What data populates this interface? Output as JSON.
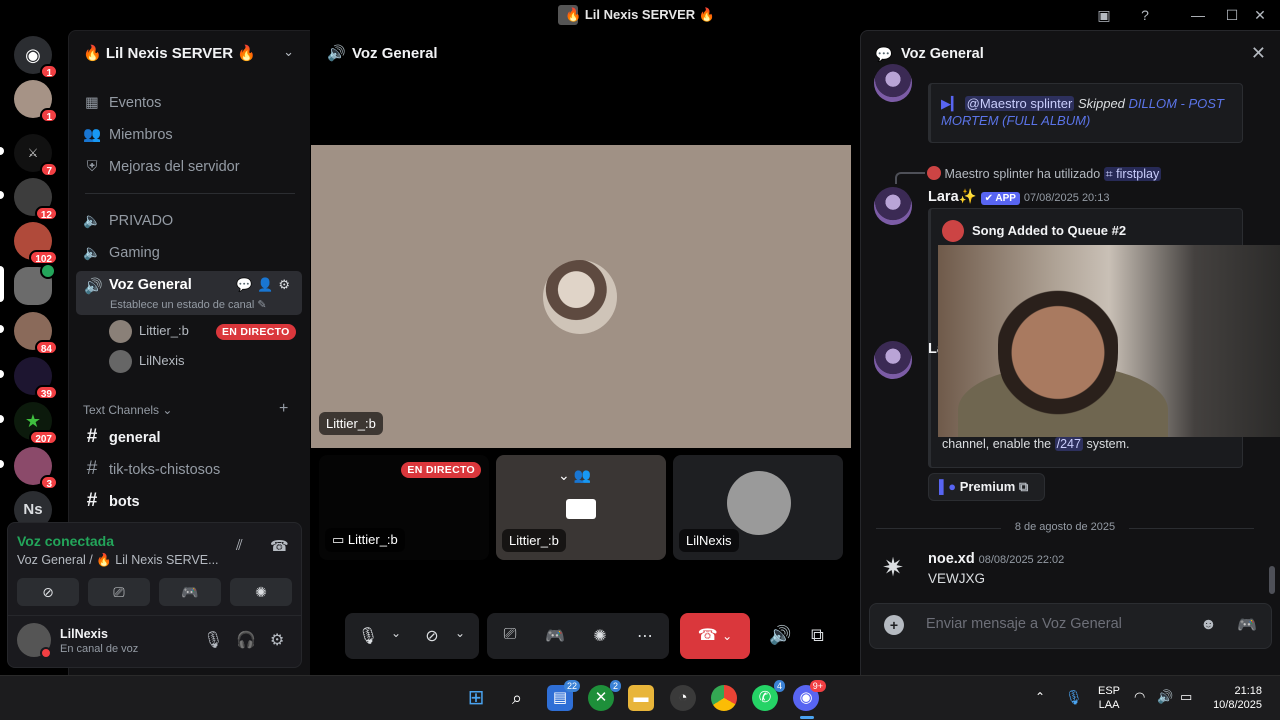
{
  "window": {
    "title": "🔥 Lil Nexis SERVER 🔥"
  },
  "rail": {
    "badges": [
      "1",
      "1",
      "7",
      "12",
      "102",
      "84",
      "39",
      "207",
      "3"
    ],
    "initials": "Ns"
  },
  "sidebar": {
    "server_name": "🔥 Lil Nexis SERVER 🔥",
    "top_items": [
      {
        "label": "Eventos"
      },
      {
        "label": "Miembros"
      },
      {
        "label": "Mejoras del servidor"
      }
    ],
    "channels": [
      {
        "label": "PRIVADO"
      },
      {
        "label": "Gaming"
      }
    ],
    "active_voice": {
      "label": "Voz General",
      "status_placeholder": "Establece un estado de canal ✎"
    },
    "voice_users": [
      {
        "name": "Littier_:b",
        "live": "EN DIRECTO"
      },
      {
        "name": "LilNexis"
      }
    ],
    "text_category": "Text Channels ⌄",
    "text_channels": [
      {
        "label": "general",
        "unread": true
      },
      {
        "label": "tik-toks-chistosos",
        "unread": false
      },
      {
        "label": "bots",
        "unread": true
      }
    ]
  },
  "voice_panel": {
    "status": "Voz conectada",
    "channel_path": "Voz General / 🔥 Lil Nexis SERVE...",
    "user_name": "LilNexis",
    "user_status": "En canal de voz"
  },
  "main": {
    "title": "Voz General",
    "stage_name": "Littier_:b",
    "tiles": [
      {
        "name": "Littier_:b",
        "live": "EN DIRECTO"
      },
      {
        "name": "Littier_:b"
      },
      {
        "name": "LilNexis"
      }
    ]
  },
  "chat": {
    "title": "Voz General",
    "msg1": {
      "mention": "@Maestro splinter",
      "action": "Skipped",
      "link": "DILLOM - POST MORTEM (FULL ALBUM)"
    },
    "system_line": {
      "user": "Maestro splinter",
      "text": "ha utilizado",
      "command": "⌗ firstplay"
    },
    "msg2": {
      "author": "Lara✨",
      "tag": "✔ APP",
      "time": "07/08/2025 20:13",
      "embed_title": "Song Added to Queue #2"
    },
    "msg3": {
      "author_partial": "La",
      "body_prefix": "channel, enable the",
      "command": "/247",
      "body_suffix": "system."
    },
    "premium_label": "Premium",
    "date_divider": "8 de agosto de 2025",
    "msg4": {
      "author": "noe.xd",
      "time": "08/08/2025 22:02",
      "text": "VEWJXG"
    },
    "input_placeholder": "Enviar mensaje a Voz General"
  },
  "taskbar": {
    "badges": {
      "widgets": "22",
      "xbox": "2",
      "whatsapp": "4",
      "discord": "9+"
    },
    "language": "ESP",
    "layout": "LAA",
    "time": "21:18",
    "date": "10/8/2025"
  },
  "colors": {
    "accent": "#5865f2",
    "danger": "#da373c",
    "online": "#23a55a"
  }
}
